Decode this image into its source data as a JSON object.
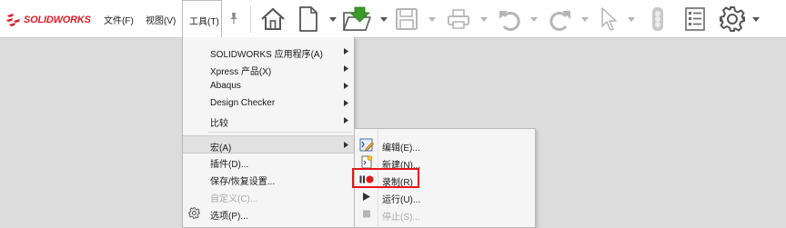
{
  "app": {
    "brand": "SOLIDWORKS"
  },
  "menubar": {
    "items": [
      {
        "label": "文件(F)"
      },
      {
        "label": "视图(V)"
      },
      {
        "label": "工具(T)"
      }
    ]
  },
  "toolbar": {
    "icons": [
      "home-icon",
      "new-document-icon",
      "open-folder-icon",
      "save-icon",
      "print-icon",
      "undo-icon",
      "redo-icon",
      "select-cursor-icon",
      "rebuild-icon",
      "file-properties-icon",
      "options-gear-icon"
    ]
  },
  "tools_menu": {
    "items": [
      {
        "label": "SOLIDWORKS 应用程序(A)",
        "has_submenu": true
      },
      {
        "label": "Xpress 产品(X)",
        "has_submenu": true
      },
      {
        "label": "Abaqus",
        "has_submenu": true
      },
      {
        "label": "Design Checker",
        "has_submenu": true
      },
      {
        "label": "比较",
        "has_submenu": true
      },
      {
        "label": "宏(A)",
        "has_submenu": true,
        "highlighted": true
      },
      {
        "label": "插件(D)...",
        "has_submenu": false
      },
      {
        "label": "保存/恢复设置...",
        "has_submenu": false
      },
      {
        "label": "自定义(C)...",
        "has_submenu": false,
        "disabled": true
      },
      {
        "label": "选项(P)...",
        "has_submenu": false
      }
    ]
  },
  "macro_menu": {
    "items": [
      {
        "label": "编辑(E)...",
        "icon": "macro-edit-icon"
      },
      {
        "label": "新建(N)...",
        "icon": "macro-new-icon"
      },
      {
        "label": "录制(R)",
        "icon": "macro-record-icon"
      },
      {
        "label": "运行(U)...",
        "icon": "macro-run-icon"
      },
      {
        "label": "停止(S)...",
        "icon": "macro-stop-icon",
        "disabled": true
      }
    ]
  },
  "colors": {
    "brand_red": "#d51e28",
    "record_red": "#e8161c",
    "open_green": "#3a9a2a",
    "icon_gray": "#6b6b6b",
    "disabled_gray": "#a8a8a8"
  }
}
